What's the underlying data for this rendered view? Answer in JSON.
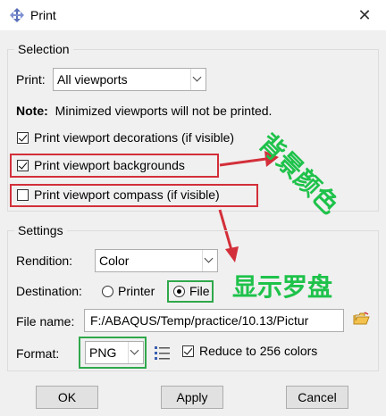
{
  "window": {
    "title": "Print",
    "close_glyph": "✕"
  },
  "selection": {
    "legend": "Selection",
    "print_label": "Print:",
    "print_value": "All viewports",
    "note_bold": "Note:",
    "note_text": "Minimized viewports will not be printed.",
    "decorations": {
      "label": "Print viewport decorations (if visible)",
      "checked": true
    },
    "backgrounds": {
      "label": "Print viewport backgrounds",
      "checked": true
    },
    "compass": {
      "label": "Print viewport compass (if visible)",
      "checked": false
    }
  },
  "settings": {
    "legend": "Settings",
    "rendition_label": "Rendition:",
    "rendition_value": "Color",
    "destination_label": "Destination:",
    "printer_label": "Printer",
    "file_label": "File",
    "destination_selected": "File",
    "filename_label": "File name:",
    "filename_value": "F:/ABAQUS/Temp/practice/10.13/Pictur",
    "format_label": "Format:",
    "format_value": "PNG",
    "reduce_label": "Reduce to 256 colors",
    "reduce_checked": true
  },
  "buttons": {
    "ok": "OK",
    "apply": "Apply",
    "cancel": "Cancel"
  },
  "annotations": {
    "background_color": "背景颜色",
    "show_compass": "显示罗盘"
  },
  "colors": {
    "highlight_red": "#d32f3a",
    "annotation_green": "#1ec24a"
  },
  "icons": [
    "print-icon",
    "close-icon",
    "folder-icon",
    "format-options-icon"
  ]
}
